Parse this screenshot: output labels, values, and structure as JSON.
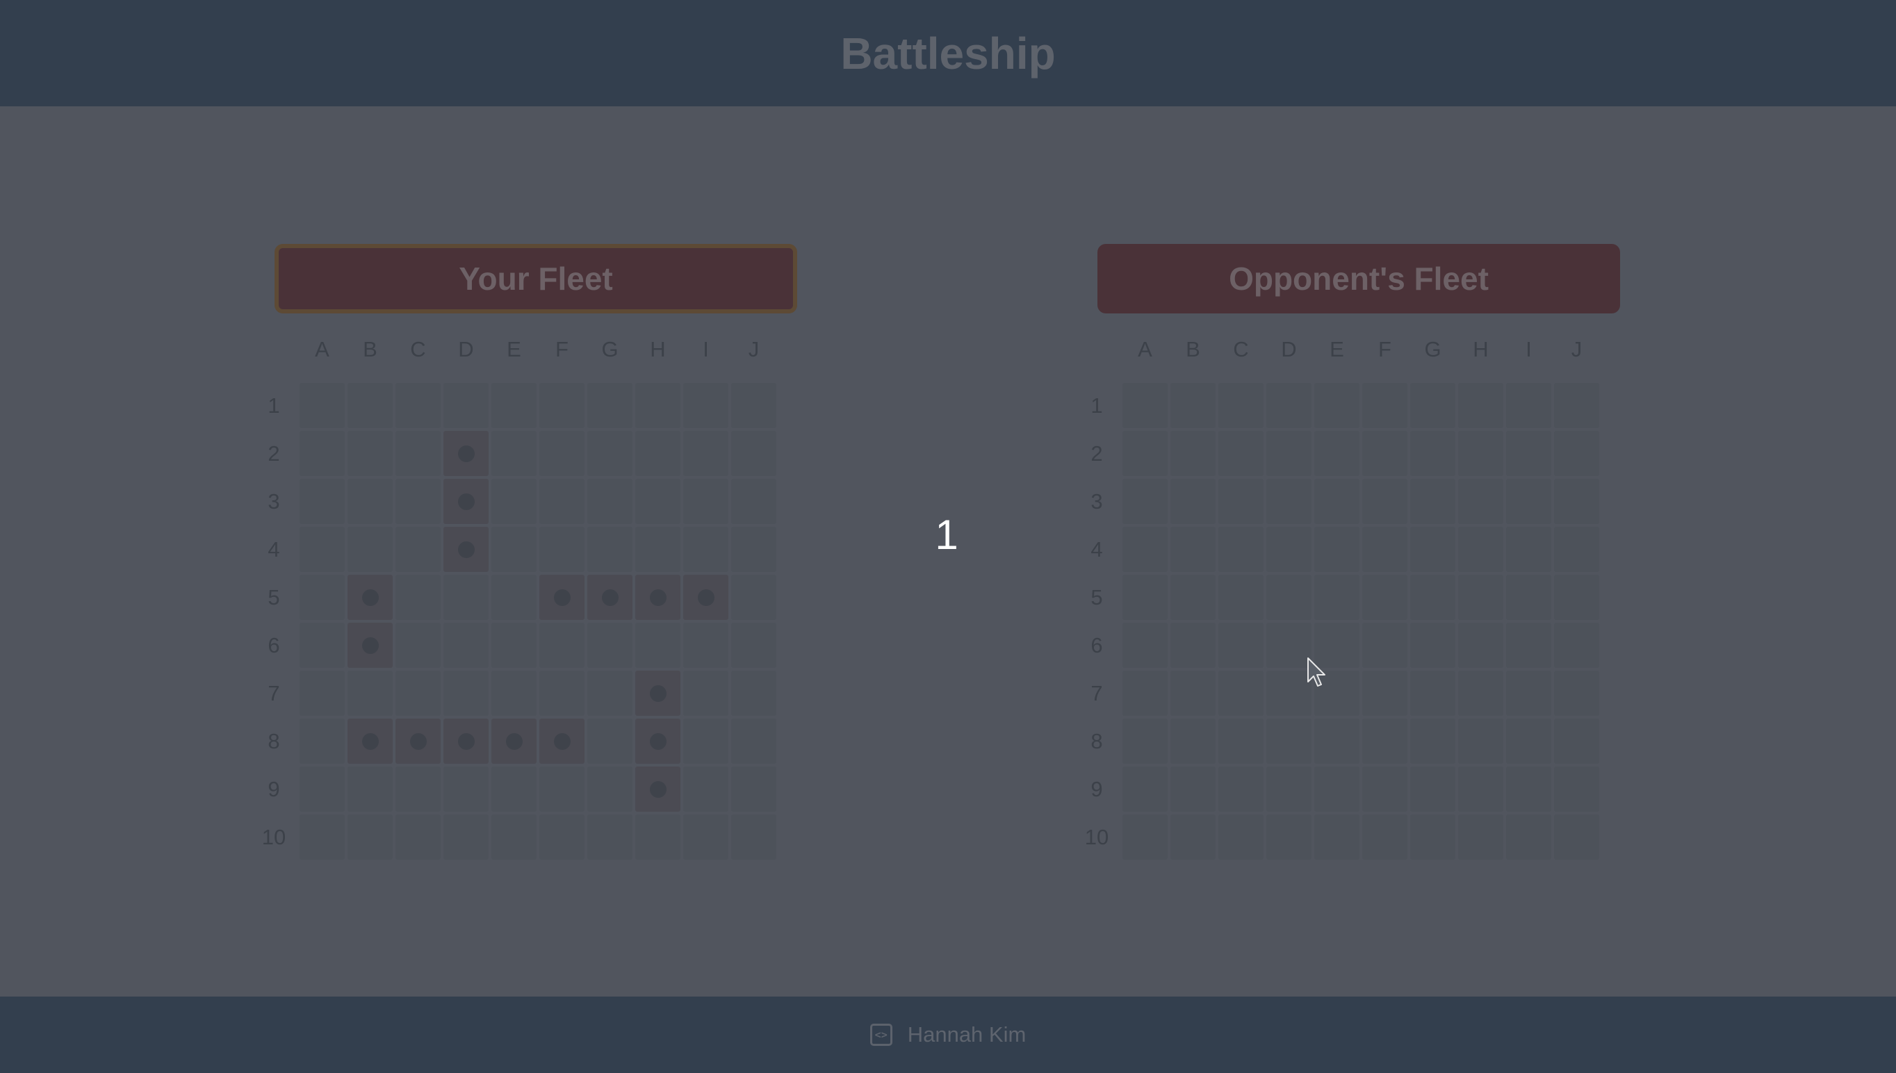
{
  "header": {
    "title": "Battleship"
  },
  "player_board": {
    "title": "Your Fleet",
    "columns": [
      "A",
      "B",
      "C",
      "D",
      "E",
      "F",
      "G",
      "H",
      "I",
      "J"
    ],
    "rows": [
      "1",
      "2",
      "3",
      "4",
      "5",
      "6",
      "7",
      "8",
      "9",
      "10"
    ],
    "ship_cells": [
      "D2",
      "D3",
      "D4",
      "B5",
      "F5",
      "G5",
      "H5",
      "I5",
      "B6",
      "H7",
      "B8",
      "C8",
      "D8",
      "E8",
      "F8",
      "H8",
      "H9"
    ]
  },
  "opponent_board": {
    "title": "Opponent's Fleet",
    "columns": [
      "A",
      "B",
      "C",
      "D",
      "E",
      "F",
      "G",
      "H",
      "I",
      "J"
    ],
    "rows": [
      "1",
      "2",
      "3",
      "4",
      "5",
      "6",
      "7",
      "8",
      "9",
      "10"
    ],
    "ship_cells": []
  },
  "turn_counter": "1",
  "footer": {
    "author": "Hannah Kim",
    "icon": "code-icon"
  },
  "colors": {
    "header_bg": "#333f4e",
    "page_bg": "#51555e",
    "fleet_button_bg": "#4a3238",
    "active_border": "#5d4a35"
  }
}
